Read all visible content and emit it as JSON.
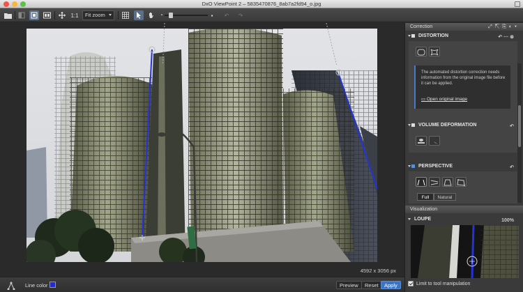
{
  "window": {
    "title": "DxO ViewPoint 2 – 5835470876_8ab7a2fd94_o.jpg"
  },
  "toolbar": {
    "zoom_11": "1:1",
    "zoom_mode": "Fit zoom"
  },
  "viewer": {
    "image_dimensions": "4592 x 3056 px"
  },
  "bottombar": {
    "line_color_label": "Line color",
    "line_color": "#1f2bd8",
    "preview_label": "Preview",
    "reset_label": "Reset",
    "apply_label": "Apply"
  },
  "panel": {
    "correction_title": "Correction",
    "distortion": {
      "title": "DISTORTION",
      "info_text": "The automated distortion correction needs information from the original image file before it can be applied.",
      "link": "Open original image"
    },
    "volume": {
      "title": "VOLUME DEFORMATION"
    },
    "perspective": {
      "title": "PERSPECTIVE",
      "mode_full": "Full",
      "mode_natural": "Natural"
    },
    "visualization_title": "Visualization",
    "loupe": {
      "title": "LOUPE",
      "zoom": "100%"
    },
    "limit_label": "Limit to tool manipulation"
  },
  "colors": {
    "accent": "#3b74c4",
    "line": "#1f2bd8"
  }
}
